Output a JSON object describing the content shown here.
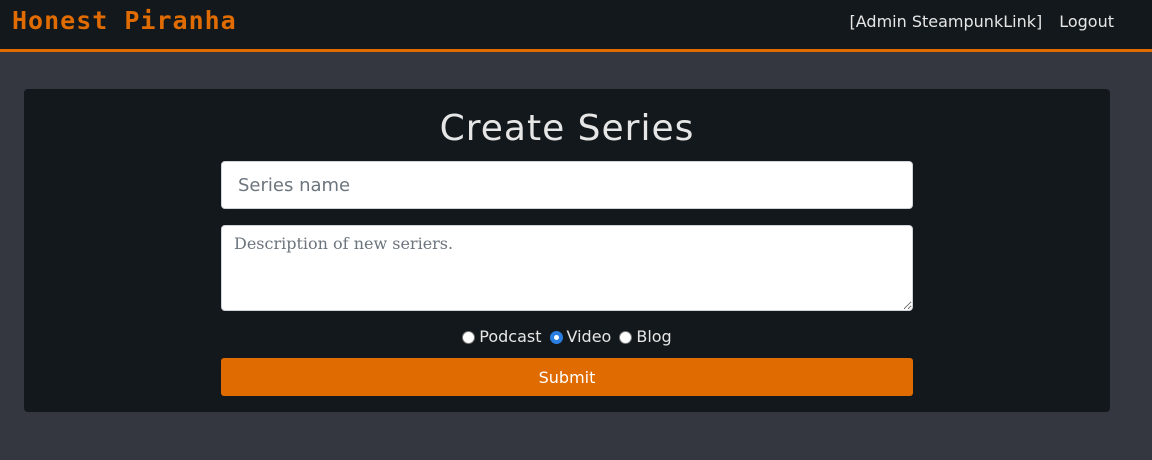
{
  "header": {
    "brand": "Honest Piranha",
    "user_label": "[Admin SteampunkLink]",
    "logout_label": "Logout"
  },
  "form": {
    "title": "Create Series",
    "name_placeholder": "Series name",
    "name_value": "",
    "description_placeholder": "Description of new seriers.",
    "description_value": "",
    "type_options": [
      {
        "label": "Podcast",
        "checked": false
      },
      {
        "label": "Video",
        "checked": true
      },
      {
        "label": "Blog",
        "checked": false
      }
    ],
    "submit_label": "Submit"
  },
  "colors": {
    "accent": "#e06b00",
    "background": "#343640",
    "panel": "#12181b",
    "radio_selected": "#2a7de1"
  }
}
